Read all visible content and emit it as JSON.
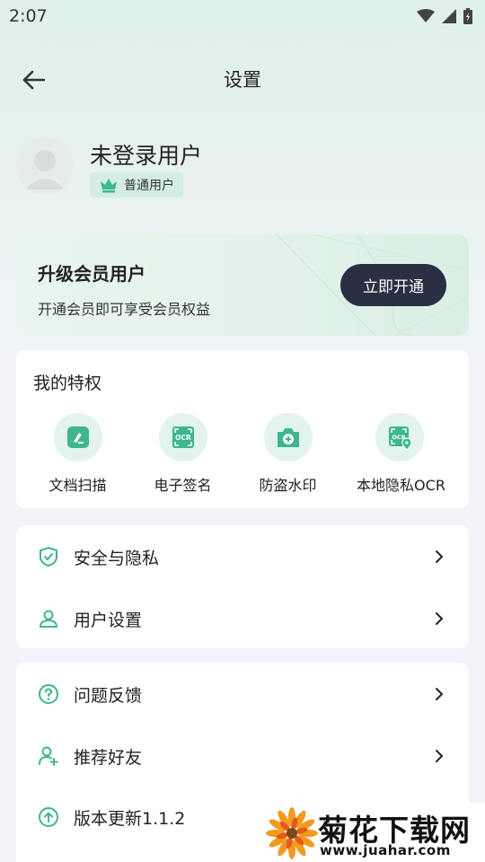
{
  "status_bar": {
    "time": "2:07"
  },
  "header": {
    "title": "设置"
  },
  "profile": {
    "name": "未登录用户",
    "badge": "普通用户"
  },
  "vip": {
    "title": "升级会员用户",
    "subtitle": "开通会员即可享受会员权益",
    "button": "立即开通"
  },
  "privileges": {
    "title": "我的特权",
    "items": [
      {
        "label": "文档扫描",
        "icon": "doc-scan-icon"
      },
      {
        "label": "电子签名",
        "icon": "ocr-sign-icon"
      },
      {
        "label": "防盗水印",
        "icon": "camera-add-icon"
      },
      {
        "label": "本地隐私OCR",
        "icon": "ocr-location-icon"
      }
    ]
  },
  "settings_group": [
    {
      "label": "安全与隐私",
      "icon": "shield-check-icon"
    },
    {
      "label": "用户设置",
      "icon": "user-icon"
    }
  ],
  "help_group": [
    {
      "label": "问题反馈",
      "icon": "question-icon"
    },
    {
      "label": "推荐好友",
      "icon": "user-plus-icon"
    },
    {
      "label": "版本更新1.1.2",
      "icon": "upload-icon"
    }
  ],
  "watermark": {
    "title": "菊花下载网",
    "url": "www.juahar.com"
  },
  "colors": {
    "accent": "#3db78b",
    "dark_button": "#2a2f44",
    "badge_bg": "#d4ede2"
  }
}
